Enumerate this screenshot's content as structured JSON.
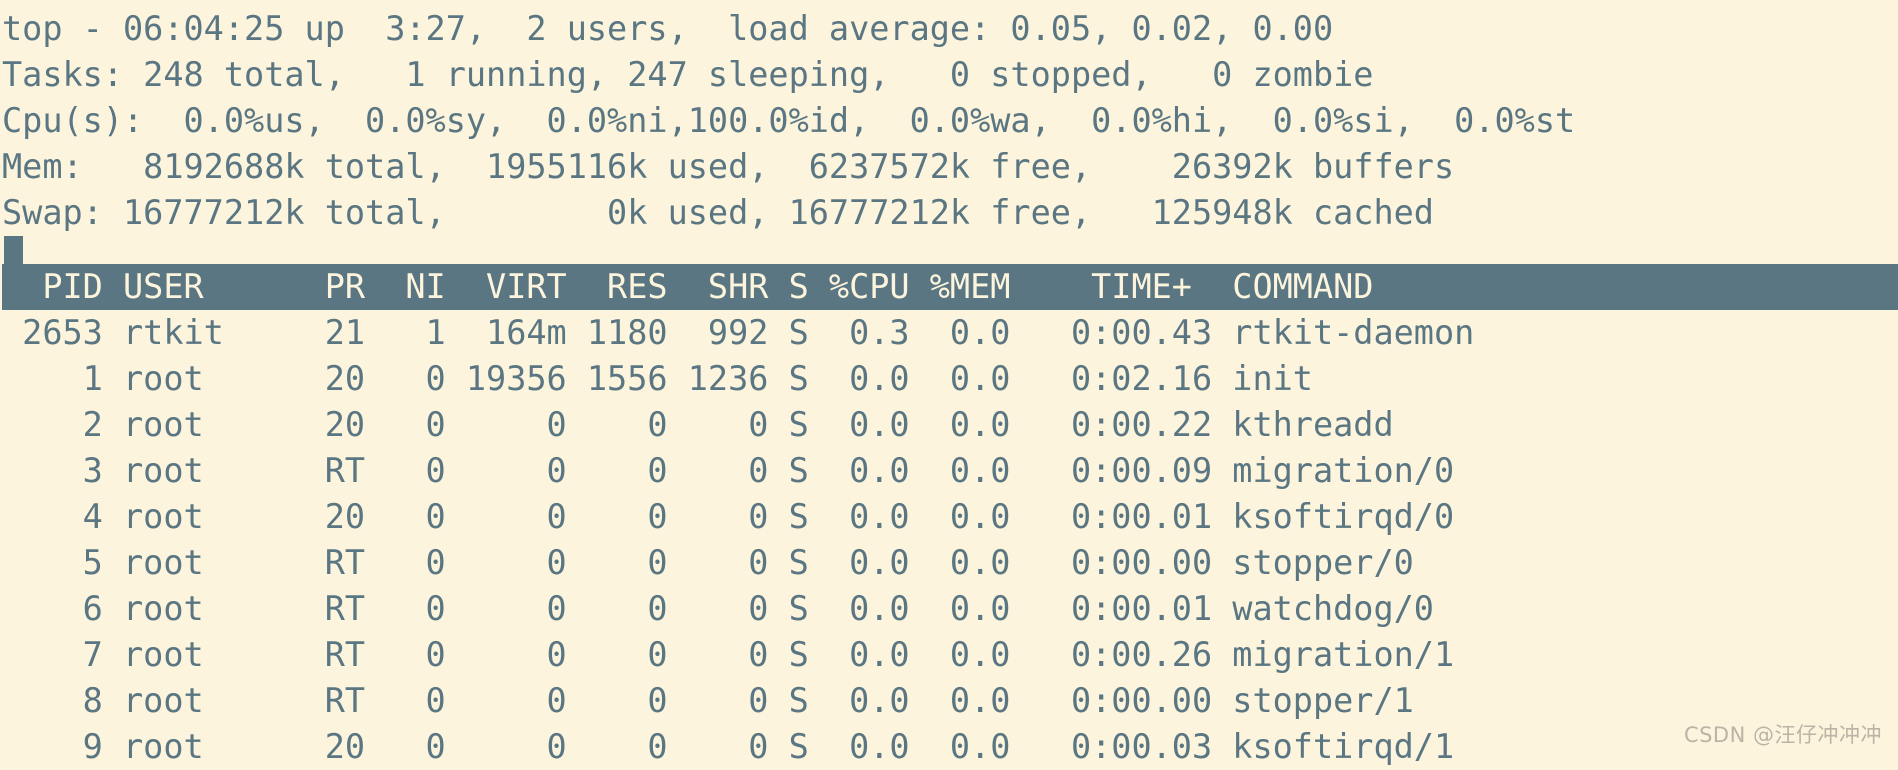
{
  "app": {
    "name": "top",
    "window_title": "top",
    "background_color": "#fcf4dc",
    "foreground_color": "#5a7682",
    "header_bar_bg": "#5a7682",
    "header_bar_fg": "#fcf4dc"
  },
  "summary": {
    "uptime_line": "top - 06:04:25 up  3:27,  2 users,  load average: 0.05, 0.02, 0.00",
    "tasks_line": "Tasks: 248 total,   1 running, 247 sleeping,   0 stopped,   0 zombie",
    "cpu_line": "Cpu(s):  0.0%us,  0.0%sy,  0.0%ni,100.0%id,  0.0%wa,  0.0%hi,  0.0%si,  0.0%st",
    "mem_line": "Mem:   8192688k total,  1955116k used,  6237572k free,    26392k buffers",
    "swap_line": "Swap: 16777212k total,        0k used, 16777212k free,   125948k cached",
    "fields": {
      "time": "06:04:25",
      "uptime": "3:27",
      "users": "2",
      "load_average_1m": "0.05",
      "load_average_5m": "0.02",
      "load_average_15m": "0.00",
      "tasks_total": "248",
      "tasks_running": "1",
      "tasks_sleeping": "247",
      "tasks_stopped": "0",
      "tasks_zombie": "0",
      "cpu_us": "0.0",
      "cpu_sy": "0.0",
      "cpu_ni": "0.0",
      "cpu_id": "100.0",
      "cpu_wa": "0.0",
      "cpu_hi": "0.0",
      "cpu_si": "0.0",
      "cpu_st": "0.0",
      "mem_total": "8192688k",
      "mem_used": "1955116k",
      "mem_free": "6237572k",
      "mem_buffers": "26392k",
      "swap_total": "16777212k",
      "swap_used": "0k",
      "swap_free": "16777212k",
      "swap_cached": "125948k"
    }
  },
  "process_table": {
    "header_line": "  PID USER      PR  NI  VIRT  RES  SHR S %CPU %MEM    TIME+  COMMAND",
    "columns": [
      "PID",
      "USER",
      "PR",
      "NI",
      "VIRT",
      "RES",
      "SHR",
      "S",
      "%CPU",
      "%MEM",
      "TIME+",
      "COMMAND"
    ],
    "rows": [
      {
        "line": " 2653 rtkit     21   1  164m 1180  992 S  0.3  0.0   0:00.43 rtkit-daemon",
        "pid": "2653",
        "user": "rtkit",
        "pr": "21",
        "ni": "1",
        "virt": "164m",
        "res": "1180",
        "shr": "992",
        "s": "S",
        "cpu": "0.3",
        "mem": "0.0",
        "time": "0:00.43",
        "command": "rtkit-daemon"
      },
      {
        "line": "    1 root      20   0 19356 1556 1236 S  0.0  0.0   0:02.16 init",
        "pid": "1",
        "user": "root",
        "pr": "20",
        "ni": "0",
        "virt": "19356",
        "res": "1556",
        "shr": "1236",
        "s": "S",
        "cpu": "0.0",
        "mem": "0.0",
        "time": "0:02.16",
        "command": "init"
      },
      {
        "line": "    2 root      20   0     0    0    0 S  0.0  0.0   0:00.22 kthreadd",
        "pid": "2",
        "user": "root",
        "pr": "20",
        "ni": "0",
        "virt": "0",
        "res": "0",
        "shr": "0",
        "s": "S",
        "cpu": "0.0",
        "mem": "0.0",
        "time": "0:00.22",
        "command": "kthreadd"
      },
      {
        "line": "    3 root      RT   0     0    0    0 S  0.0  0.0   0:00.09 migration/0",
        "pid": "3",
        "user": "root",
        "pr": "RT",
        "ni": "0",
        "virt": "0",
        "res": "0",
        "shr": "0",
        "s": "S",
        "cpu": "0.0",
        "mem": "0.0",
        "time": "0:00.09",
        "command": "migration/0"
      },
      {
        "line": "    4 root      20   0     0    0    0 S  0.0  0.0   0:00.01 ksoftirqd/0",
        "pid": "4",
        "user": "root",
        "pr": "20",
        "ni": "0",
        "virt": "0",
        "res": "0",
        "shr": "0",
        "s": "S",
        "cpu": "0.0",
        "mem": "0.0",
        "time": "0:00.01",
        "command": "ksoftirqd/0"
      },
      {
        "line": "    5 root      RT   0     0    0    0 S  0.0  0.0   0:00.00 stopper/0",
        "pid": "5",
        "user": "root",
        "pr": "RT",
        "ni": "0",
        "virt": "0",
        "res": "0",
        "shr": "0",
        "s": "S",
        "cpu": "0.0",
        "mem": "0.0",
        "time": "0:00.00",
        "command": "stopper/0"
      },
      {
        "line": "    6 root      RT   0     0    0    0 S  0.0  0.0   0:00.01 watchdog/0",
        "pid": "6",
        "user": "root",
        "pr": "RT",
        "ni": "0",
        "virt": "0",
        "res": "0",
        "shr": "0",
        "s": "S",
        "cpu": "0.0",
        "mem": "0.0",
        "time": "0:00.01",
        "command": "watchdog/0"
      },
      {
        "line": "    7 root      RT   0     0    0    0 S  0.0  0.0   0:00.26 migration/1",
        "pid": "7",
        "user": "root",
        "pr": "RT",
        "ni": "0",
        "virt": "0",
        "res": "0",
        "shr": "0",
        "s": "S",
        "cpu": "0.0",
        "mem": "0.0",
        "time": "0:00.26",
        "command": "migration/1"
      },
      {
        "line": "    8 root      RT   0     0    0    0 S  0.0  0.0   0:00.00 stopper/1",
        "pid": "8",
        "user": "root",
        "pr": "RT",
        "ni": "0",
        "virt": "0",
        "res": "0",
        "shr": "0",
        "s": "S",
        "cpu": "0.0",
        "mem": "0.0",
        "time": "0:00.00",
        "command": "stopper/1"
      },
      {
        "line": "    9 root      20   0     0    0    0 S  0.0  0.0   0:00.03 ksoftirqd/1",
        "pid": "9",
        "user": "root",
        "pr": "20",
        "ni": "0",
        "virt": "0",
        "res": "0",
        "shr": "0",
        "s": "S",
        "cpu": "0.0",
        "mem": "0.0",
        "time": "0:00.03",
        "command": "ksoftirqd/1"
      }
    ]
  },
  "watermark": {
    "text": "CSDN @汪仔冲冲冲"
  }
}
